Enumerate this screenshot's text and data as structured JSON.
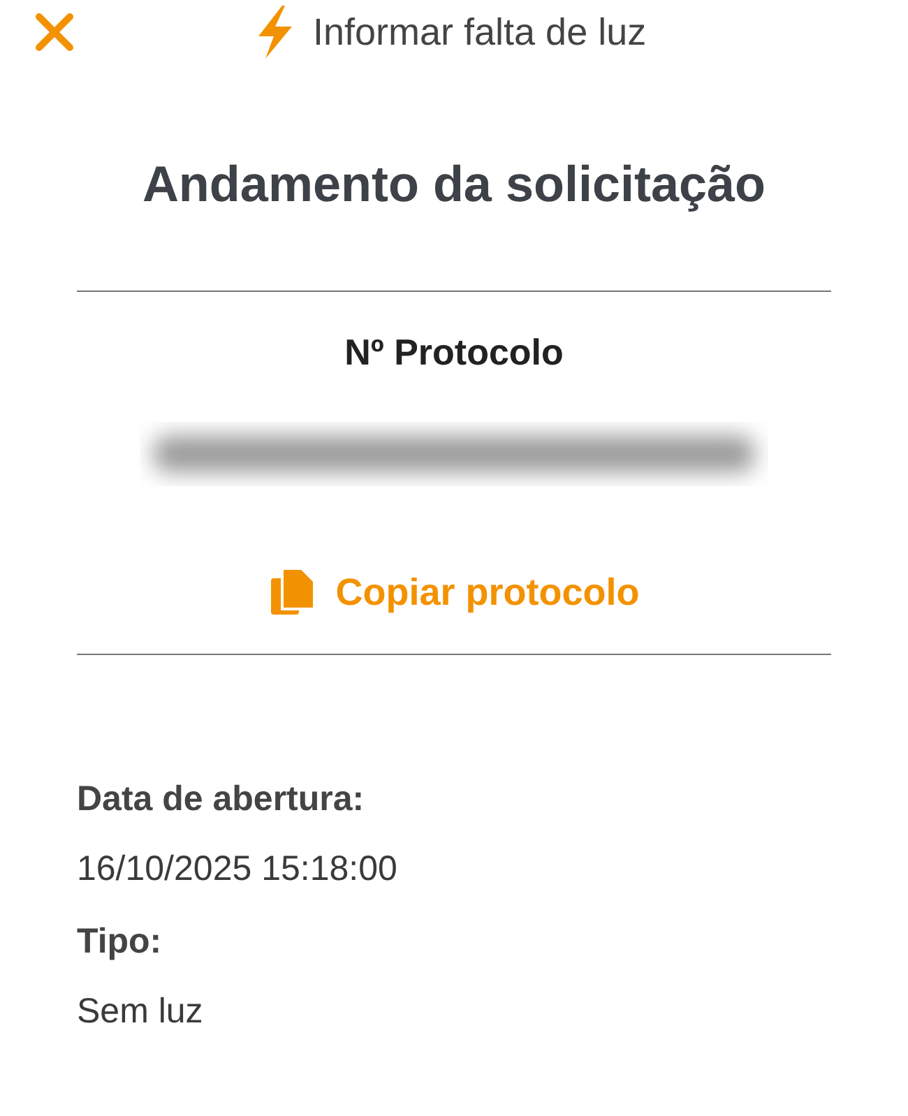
{
  "header": {
    "title": "Informar falta de luz"
  },
  "page_title": "Andamento da solicitação",
  "protocol": {
    "label": "Nº Protocolo",
    "action": "Copiar protocolo"
  },
  "details": [
    {
      "label": "Data de abertura:",
      "value": "16/10/2025 15:18:00"
    },
    {
      "label": "Tipo:",
      "value": "Sem luz"
    }
  ]
}
